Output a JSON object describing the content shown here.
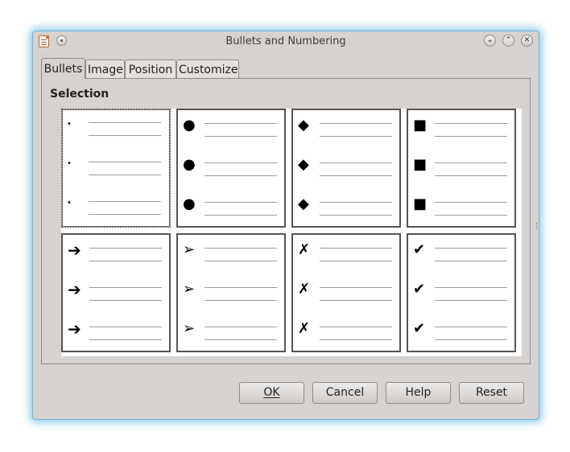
{
  "window": {
    "title": "Bullets and Numbering"
  },
  "tabs": [
    {
      "label": "Bullets",
      "active": true
    },
    {
      "label": "Image",
      "active": false
    },
    {
      "label": "Position",
      "active": false
    },
    {
      "label": "Customize",
      "active": false
    }
  ],
  "selection": {
    "heading": "Selection",
    "selected_index": 0,
    "options": [
      {
        "name": "small-dot",
        "glyph": "•"
      },
      {
        "name": "large-circle",
        "glyph": "●"
      },
      {
        "name": "diamond",
        "glyph": "◆"
      },
      {
        "name": "square",
        "glyph": "■"
      },
      {
        "name": "arrow",
        "glyph": "➔"
      },
      {
        "name": "arrowhead",
        "glyph": "➢"
      },
      {
        "name": "x-mark",
        "glyph": "✗"
      },
      {
        "name": "check-mark",
        "glyph": "✔"
      }
    ]
  },
  "buttons": {
    "ok": "OK",
    "cancel": "Cancel",
    "help": "Help",
    "reset": "Reset"
  }
}
